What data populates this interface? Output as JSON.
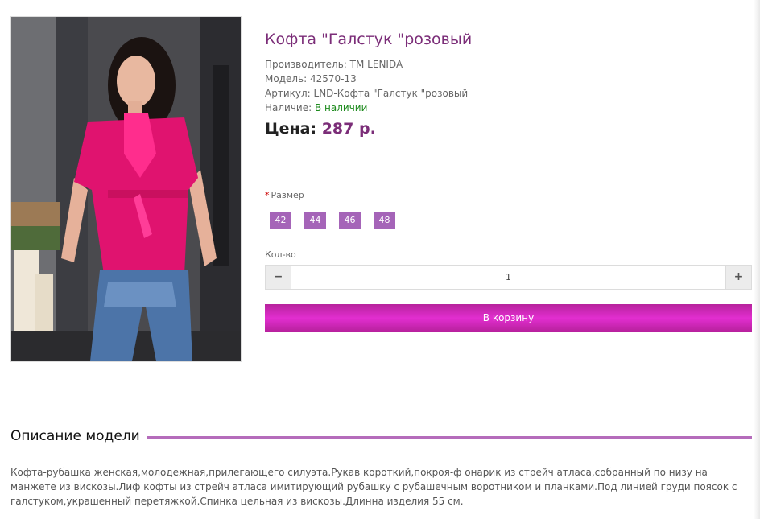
{
  "product": {
    "title": "Кофта \"Галстук \"розовый",
    "image_alt": "Кофта Галстук розовый"
  },
  "meta": {
    "manufacturer_label": "Производитель:",
    "manufacturer_value": "TM LENIDA",
    "model_label": "Модель:",
    "model_value": "42570-13",
    "sku_label": "Артикул:",
    "sku_value": "LND-Кофта \"Галстук \"розовый",
    "stock_label": "Наличие:",
    "stock_value": "В наличии"
  },
  "price": {
    "label": "Цена:",
    "value": "287 р."
  },
  "options": {
    "size_required_mark": "*",
    "size_label": "Размер",
    "sizes": [
      "42",
      "44",
      "46",
      "48"
    ]
  },
  "quantity": {
    "label": "Кол-во",
    "minus": "−",
    "plus": "+",
    "value": "1"
  },
  "cart": {
    "button_label": "В корзину"
  },
  "description": {
    "heading": "Описание модели",
    "text": "Кофта-рубашка женская,молодежная,прилегающего силуэта.Рукав короткий,покроя-ф онарик из стрейч атласа,собранный по низу на манжете из вискозы.Лиф кофты из стрейч атласа имитирующий рубашку с рубашечным воротником и планками.Под линией груди поясок с галстуком,украшенный перетяжкой.Спинка цельная из вискозы.Длинна изделия 55 см."
  },
  "colors": {
    "accent": "#7b2d78",
    "size_button": "#a564b8",
    "cart_button": "#d22bbf",
    "in_stock": "#1c8a1c",
    "heading_line": "#b56cbb"
  }
}
